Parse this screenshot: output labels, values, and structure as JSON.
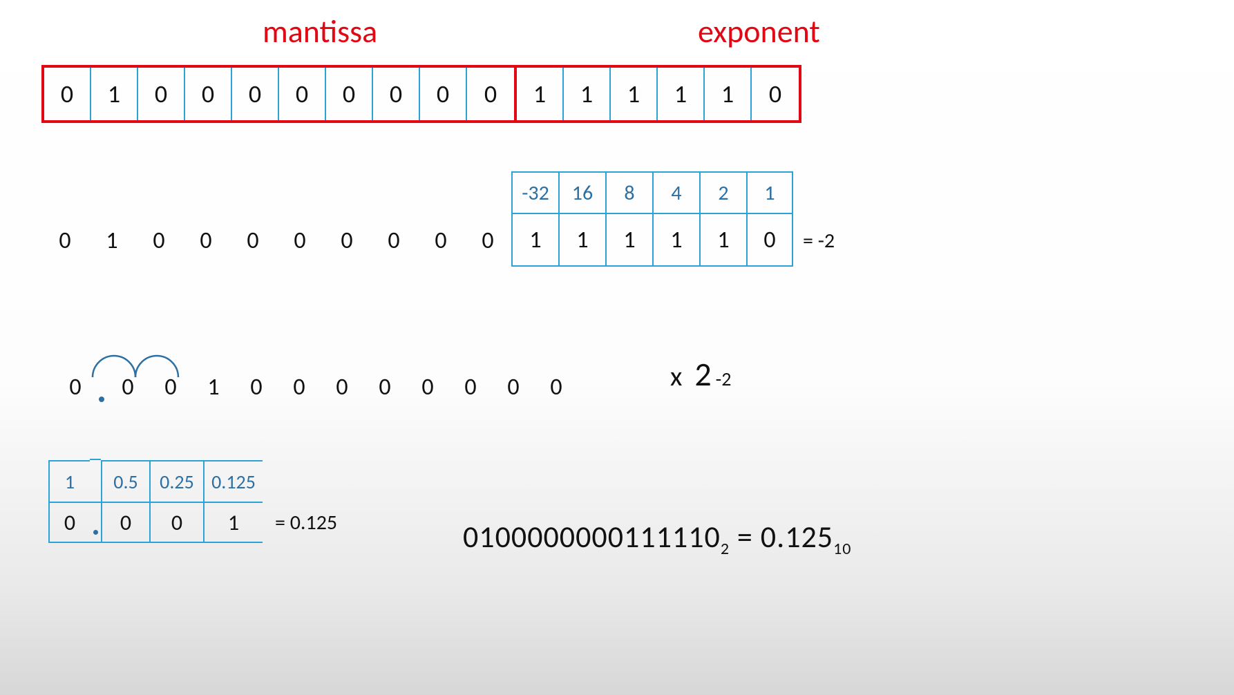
{
  "labels": {
    "mantissa": "mantissa",
    "exponent": "exponent"
  },
  "top_bits": {
    "mantissa": [
      "0",
      "1",
      "0",
      "0",
      "0",
      "0",
      "0",
      "0",
      "0",
      "0"
    ],
    "exponent": [
      "1",
      "1",
      "1",
      "1",
      "1",
      "0"
    ]
  },
  "mid": {
    "mantissa_bits": [
      "0",
      "1",
      "0",
      "0",
      "0",
      "0",
      "0",
      "0",
      "0",
      "0"
    ],
    "exponent_weights": [
      "-32",
      "16",
      "8",
      "4",
      "2",
      "1"
    ],
    "exponent_bits": [
      "1",
      "1",
      "1",
      "1",
      "1",
      "0"
    ],
    "exponent_eq": "= -2"
  },
  "shift": {
    "digits": [
      "0",
      ".",
      "0",
      "0",
      "1",
      "0",
      "0",
      "0",
      "0",
      "0",
      "0",
      "0",
      "0"
    ],
    "mult_x": "x",
    "mult_base": "2",
    "mult_exp": "-2"
  },
  "frac": {
    "heads": [
      "1",
      "0.5",
      "0.25",
      "0.125"
    ],
    "vals": [
      "0",
      "0",
      "0",
      "1"
    ],
    "eq": "= 0.125"
  },
  "final": {
    "bin": "0100000000111110",
    "bin_sub": "2",
    "eq": " = ",
    "dec": "0.125",
    "dec_sub": "10"
  }
}
